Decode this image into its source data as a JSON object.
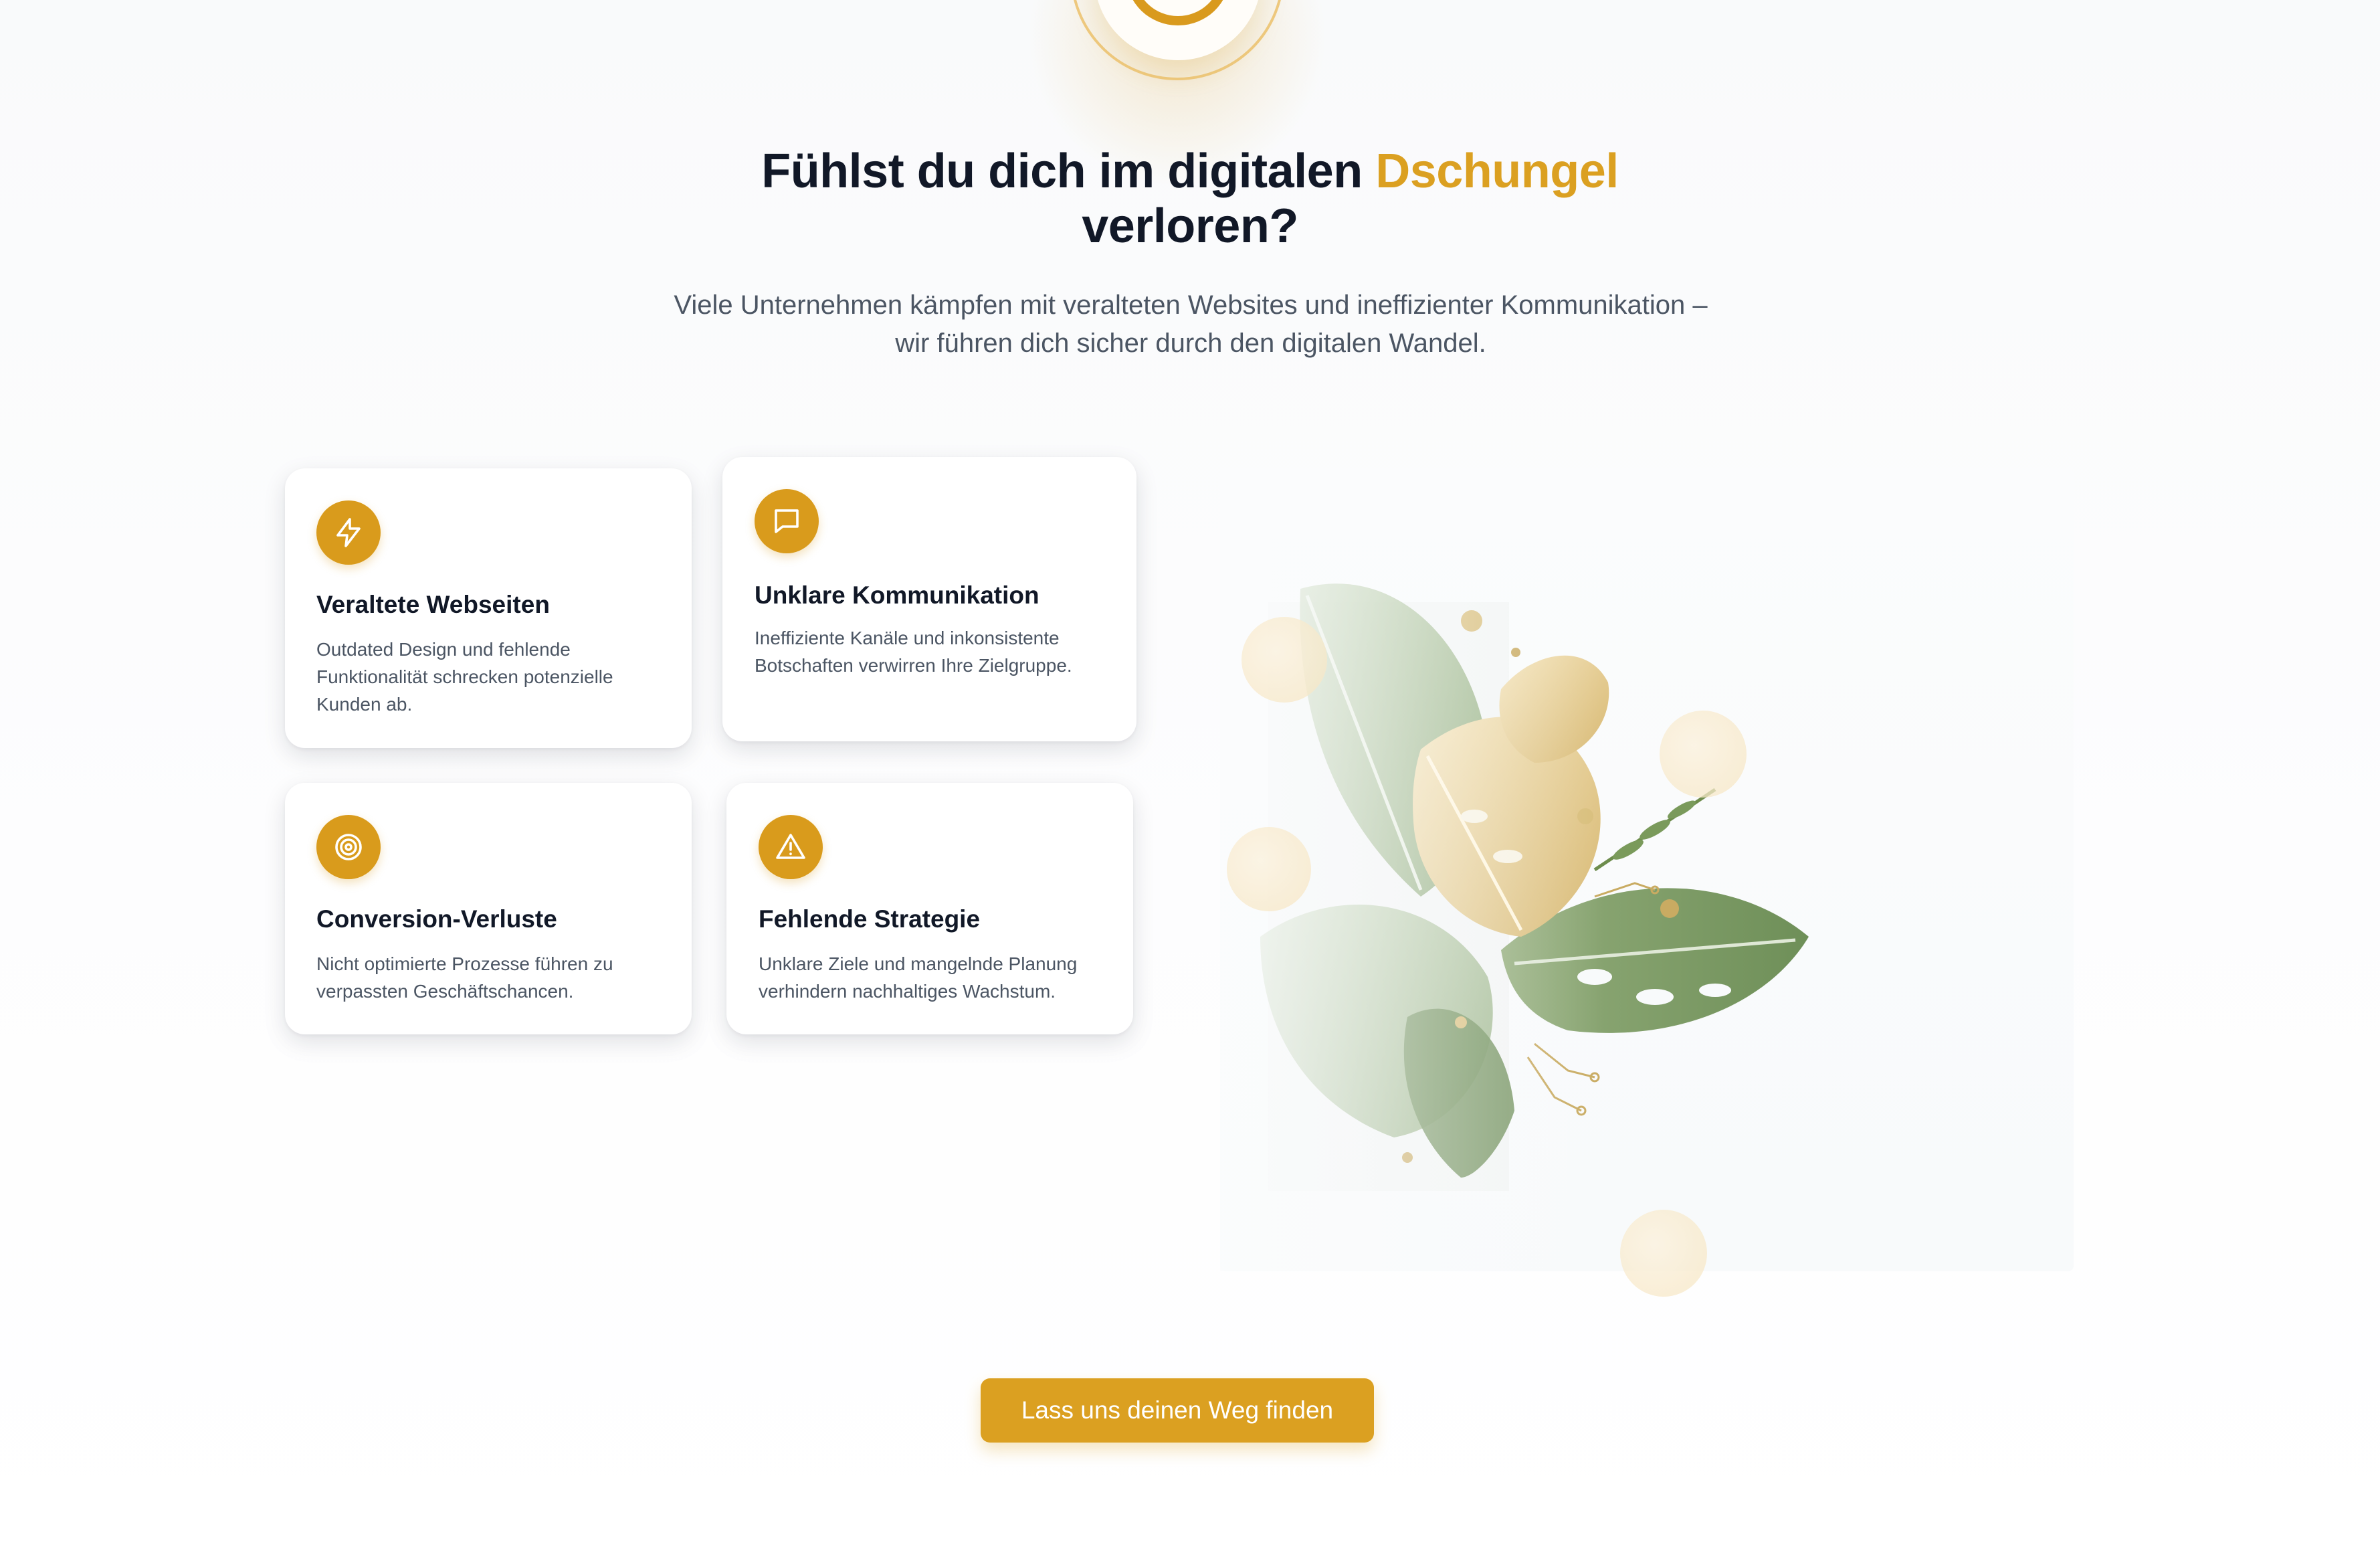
{
  "hero": {
    "title_part1": "Fühlst du dich im digitalen ",
    "title_accent": "Dschungel",
    "title_part2": "verloren?",
    "intro_line1": "Viele Unternehmen kämpfen mit veralteten Websites und ineffizienter Kommunikation –",
    "intro_line2": "wir führen dich sicher durch den digitalen Wandel."
  },
  "cards": [
    {
      "icon": "lightning-icon",
      "title": "Veraltete Webseiten",
      "text": "Outdated Design und fehlende Funktionalität schrecken potenzielle Kunden ab."
    },
    {
      "icon": "message-icon",
      "title": "Unklare Kommunikation",
      "text": "Ineffiziente Kanäle und inkonsistente Botschaften verwirren Ihre Zielgruppe."
    },
    {
      "icon": "target-icon",
      "title": "Conversion-Verluste",
      "text": "Nicht optimierte Prozesse führen zu verpassten Geschäftschancen."
    },
    {
      "icon": "warning-icon",
      "title": "Fehlende Strategie",
      "text": "Unklare Ziele und mangelnde Planung verhindern nachhaltiges Wachstum."
    }
  ],
  "illustration": {
    "subject": "jungle-leaves-illustration"
  },
  "cta": {
    "label": "Lass uns deinen Weg finden"
  },
  "colors": {
    "accent": "#dba021",
    "heading": "#111827",
    "body": "#4b5563",
    "card_bg": "#ffffff"
  }
}
